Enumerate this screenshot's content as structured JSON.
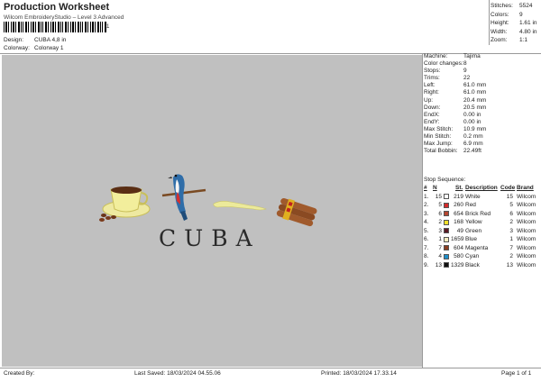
{
  "header": {
    "title": "Production Worksheet",
    "subtitle": "Wilcom EmbroideryStudio – Level 3 Advanced",
    "barcode_text": "1",
    "design_label": "Design:",
    "design_value": "CUBA 4,8 in",
    "colorway_label": "Colorway:",
    "colorway_value": "Colorway 1"
  },
  "summary": [
    {
      "label": "Stitches:",
      "value": "5524"
    },
    {
      "label": "Colors:",
      "value": "9"
    },
    {
      "label": "Height:",
      "value": "1.61 in"
    },
    {
      "label": "Width:",
      "value": "4.80 in"
    },
    {
      "label": "Zoom:",
      "value": "1:1"
    }
  ],
  "preview": {
    "text": "CUBA",
    "background": "#c0c0c0"
  },
  "machine_info": [
    {
      "label": "Machine:",
      "value": "Tajima"
    },
    {
      "label": "Color changes:",
      "value": "8"
    },
    {
      "label": "Stops:",
      "value": "9"
    },
    {
      "label": "Trims:",
      "value": "22"
    },
    {
      "label": "Left:",
      "value": "61.0 mm"
    },
    {
      "label": "Right:",
      "value": "61.0 mm"
    },
    {
      "label": "Up:",
      "value": "20.4 mm"
    },
    {
      "label": "Down:",
      "value": "20.5 mm"
    },
    {
      "label": "EndX:",
      "value": "0.00 in"
    },
    {
      "label": "EndY:",
      "value": "0.00 in"
    },
    {
      "label": "Max Stitch:",
      "value": "10.9 mm"
    },
    {
      "label": "Min Stitch:",
      "value": "0.2 mm"
    },
    {
      "label": "Max Jump:",
      "value": "6.9 mm"
    },
    {
      "label": "Total Bobbin:",
      "value": "22.49ft"
    }
  ],
  "stop_sequence": {
    "title": "Stop Sequence:",
    "headers": [
      "#",
      "N",
      "St.",
      "Description",
      "Code",
      "Brand"
    ],
    "rows": [
      {
        "num": "1.",
        "n": "15",
        "color": "#ffffff",
        "st": "219",
        "desc": "White",
        "code": "15",
        "brand": "Wilcom"
      },
      {
        "num": "2.",
        "n": "5",
        "color": "#d42a2a",
        "st": "260",
        "desc": "Red",
        "code": "5",
        "brand": "Wilcom"
      },
      {
        "num": "3.",
        "n": "6",
        "color": "#b5452f",
        "st": "654",
        "desc": "Brick Red",
        "code": "6",
        "brand": "Wilcom"
      },
      {
        "num": "4.",
        "n": "2",
        "color": "#f2e02a",
        "st": "168",
        "desc": "Yellow",
        "code": "2",
        "brand": "Wilcom"
      },
      {
        "num": "5.",
        "n": "3",
        "color": "#5a1a24",
        "st": "49",
        "desc": "Green",
        "code": "3",
        "brand": "Wilcom"
      },
      {
        "num": "6.",
        "n": "1",
        "color": "#f4ecc0",
        "st": "1659",
        "desc": "Blue",
        "code": "1",
        "brand": "Wilcom"
      },
      {
        "num": "7.",
        "n": "7",
        "color": "#8a3e22",
        "st": "604",
        "desc": "Magenta",
        "code": "7",
        "brand": "Wilcom"
      },
      {
        "num": "8.",
        "n": "4",
        "color": "#1e8ec9",
        "st": "580",
        "desc": "Cyan",
        "code": "2",
        "brand": "Wilcom"
      },
      {
        "num": "9.",
        "n": "13",
        "color": "#111111",
        "st": "1329",
        "desc": "Black",
        "code": "13",
        "brand": "Wilcom"
      }
    ]
  },
  "footer": {
    "created_by": "Created By:",
    "last_saved": "Last Saved: 18/03/2024 04.55.06",
    "printed": "Printed: 18/03/2024 17.33.14",
    "page": "Page 1 of 1"
  }
}
